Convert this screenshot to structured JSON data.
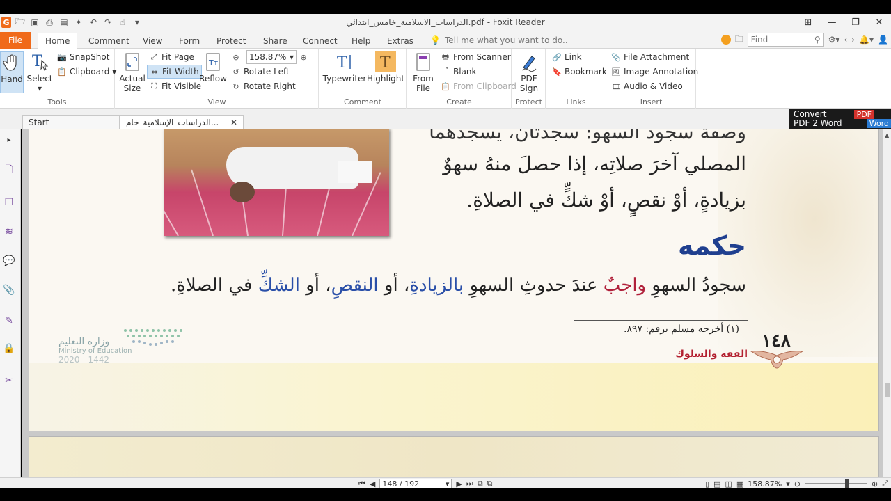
{
  "window": {
    "title": "الدراسات_الاسلامية_خامس_ابتدائي.pdf - Foxit Reader",
    "app_letter": "G"
  },
  "menu": {
    "file": "File",
    "tabs": [
      "Home",
      "Comment",
      "View",
      "Form",
      "Protect",
      "Share",
      "Connect",
      "Help",
      "Extras"
    ],
    "tell_me": "Tell me what you want to do..",
    "find_placeholder": "Find"
  },
  "ribbon": {
    "tools": {
      "label": "Tools",
      "hand": "Hand",
      "select": "Select",
      "snapshot": "SnapShot",
      "clipboard": "Clipboard"
    },
    "view": {
      "label": "View",
      "actual_size_1": "Actual",
      "actual_size_2": "Size",
      "fit_page": "Fit Page",
      "fit_width": "Fit Width",
      "fit_visible": "Fit Visible",
      "reflow": "Reflow",
      "zoom": "158.87%",
      "rotate_left": "Rotate Left",
      "rotate_right": "Rotate Right"
    },
    "comment": {
      "label": "Comment",
      "typewriter": "Typewriter",
      "highlight": "Highlight"
    },
    "create": {
      "label": "Create",
      "from_file_1": "From",
      "from_file_2": "File",
      "from_scanner": "From Scanner",
      "blank": "Blank",
      "from_clipboard": "From Clipboard"
    },
    "protect": {
      "label": "Protect",
      "pdf_sign_1": "PDF",
      "pdf_sign_2": "Sign"
    },
    "links": {
      "label": "Links",
      "link": "Link",
      "bookmark": "Bookmark"
    },
    "insert": {
      "label": "Insert",
      "file_attachment": "File Attachment",
      "image_annotation": "Image Annotation",
      "audio_video": "Audio & Video"
    }
  },
  "doc_tabs": {
    "start": "Start",
    "current": "الدراسات_الإسلامية_خام..."
  },
  "convert": {
    "line1": "Convert",
    "line2": "PDF 2 Word",
    "pdf": "PDF",
    "word": "Word"
  },
  "document": {
    "line_top": "وصفة سجود السهو: سجدتان، يسجدهما",
    "line1": "المصلي آخرَ صلاتِه، إذا حصلَ منهُ سهوٌ",
    "line2": "بزيادةٍ، أوْ نقصٍ، أوْ شكٍّ في الصلاةِ.",
    "heading": "حكمه",
    "body_a": "سجودُ السهوِ ",
    "body_red": "واجبٌ",
    "body_b": " عندَ حدوثِ السهوِ ",
    "body_blue1": "بالزيادةِ",
    "body_c": "، أو ",
    "body_blue2": "النقصِ",
    "body_d": "، أو ",
    "body_blue3": "الشكِّ",
    "body_e": " في الصلاةِ.",
    "footnote": "(١) أخرجه مسلم برقم: ٨٩٧.",
    "page_number": "١٤٨",
    "subject": "الفقه والسلوك",
    "ministry_ar": "وزارة التعليم",
    "ministry_en": "Ministry of Education",
    "ministry_year": "2020 - 1442"
  },
  "status": {
    "page": "148 / 192",
    "zoom": "158.87%"
  },
  "colors": {
    "accent": "#f06a1a",
    "heading_blue": "#1f3f8f",
    "red_word": "#b0203a",
    "blue_word": "#2a4fa8"
  }
}
